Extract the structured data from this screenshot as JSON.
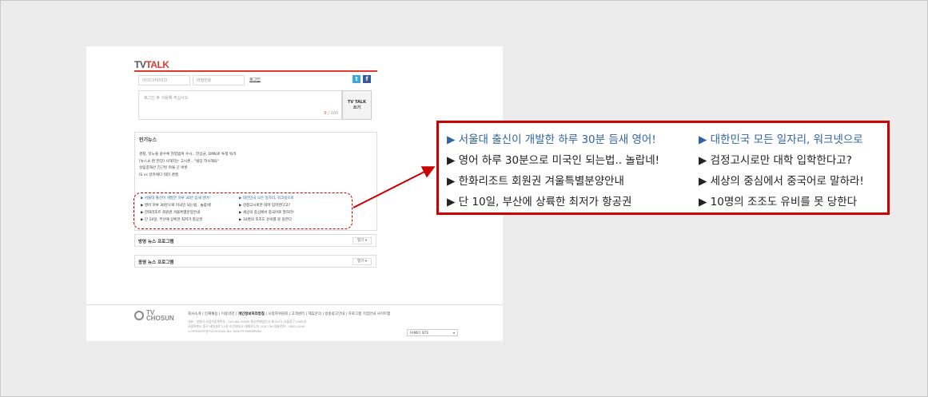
{
  "logo": {
    "tv": "TV",
    "talk": "TALK"
  },
  "login": {
    "id_placeholder": "아이디(아이디)",
    "pw_placeholder": "비밀번호",
    "button_label": "로그인"
  },
  "sns": {
    "twitter_icon": "twitter-icon",
    "facebook_icon": "facebook-icon",
    "twitter_glyph": "t",
    "facebook_glyph": "f"
  },
  "comment": {
    "placeholder": "로그인 후 사용해 주십시오",
    "count": "0",
    "max": "/ 100",
    "send_line1": "TV TALK",
    "send_line2": "쓰기"
  },
  "popular_news": {
    "title": "인기뉴스",
    "items": [
      "경찰, 잇노출 갈수록 현업범위 수사…한상균, DMB로 투쟁 독려",
      "[뉴스쇼 판 현장] 사재지는 고시촌…\"빌딩 학사해요\"",
      "살림종해산 진근된 마을 곤 버릇",
      "IS vs 알카에다 테러 경쟁"
    ]
  },
  "mini_left": [
    "▶ 서울대 출신이 개발한 하루 30분 듬새 영어!",
    "▶ 영어 하루 30분으로 미국인 되는법.. 놀랍네!",
    "▶ 한화리조트 회원권 겨울특별분양안내",
    "▶ 단 10일, 부산에 상륙한 최저가 항공권"
  ],
  "mini_right": [
    "▶ 대한민국 모든 일자리, 워크넷으로",
    "▶ 검정고시로만 대학 입학한다고?",
    "▶ 세상의 중심에서 중국어로 말하라!",
    "▶ 10명의 조조도 유비를 못 당한다"
  ],
  "programs": [
    {
      "title": "방영 뉴스 프로그램",
      "more": "열기 ▾"
    },
    {
      "title": "종영 뉴스 프로그램",
      "more": "열기 ▾"
    }
  ],
  "footer": {
    "brand_line1": "TV",
    "brand_line2": "CHOSUN",
    "menu_a": "회사소개 | 인재채용 | 이용약관 | ",
    "menu_b": "개인정보처리방침",
    "menu_c": " | 시청자위원회 | 고객센터 | 제휴문의 | 방송광고안내 | 프로그램 기업안내 사이트맵",
    "info1": "대표 : 방원식    사업자등록번호 : 104-86-35560    통신판매업신고 제 2011-서울중구-1561호",
    "info2": "서울특별시 중구 세종대로 21길 조선일보사 (태평로1가) 100-756    대표전화 : 1661-0190",
    "info3": "COPYRIGHT@TVCHOSUN ALL RIGHTS RESERVED",
    "family_site": "FAMILY SITE"
  },
  "callout": {
    "left": [
      "▶ 서울대 출신이 개발한 하루 30분 듬새 영어!",
      "▶ 영어 하루 30분으로 미국인 되는법.. 놀랍네!",
      "▶ 한화리조트 회원권 겨울특별분양안내",
      "▶ 단 10일, 부산에 상륙한 최저가 항공권"
    ],
    "right": [
      "▶ 대한민국 모든 일자리, 워크넷으로",
      "▶ 검정고시로만 대학 입학한다고?",
      "▶ 세상의 중심에서 중국어로 말하라!",
      "▶ 10명의 조조도 유비를 못 당한다"
    ]
  },
  "colors": {
    "accent": "#e23a2e",
    "link_blue": "#2f63a6",
    "callout_border": "#cc0000"
  }
}
